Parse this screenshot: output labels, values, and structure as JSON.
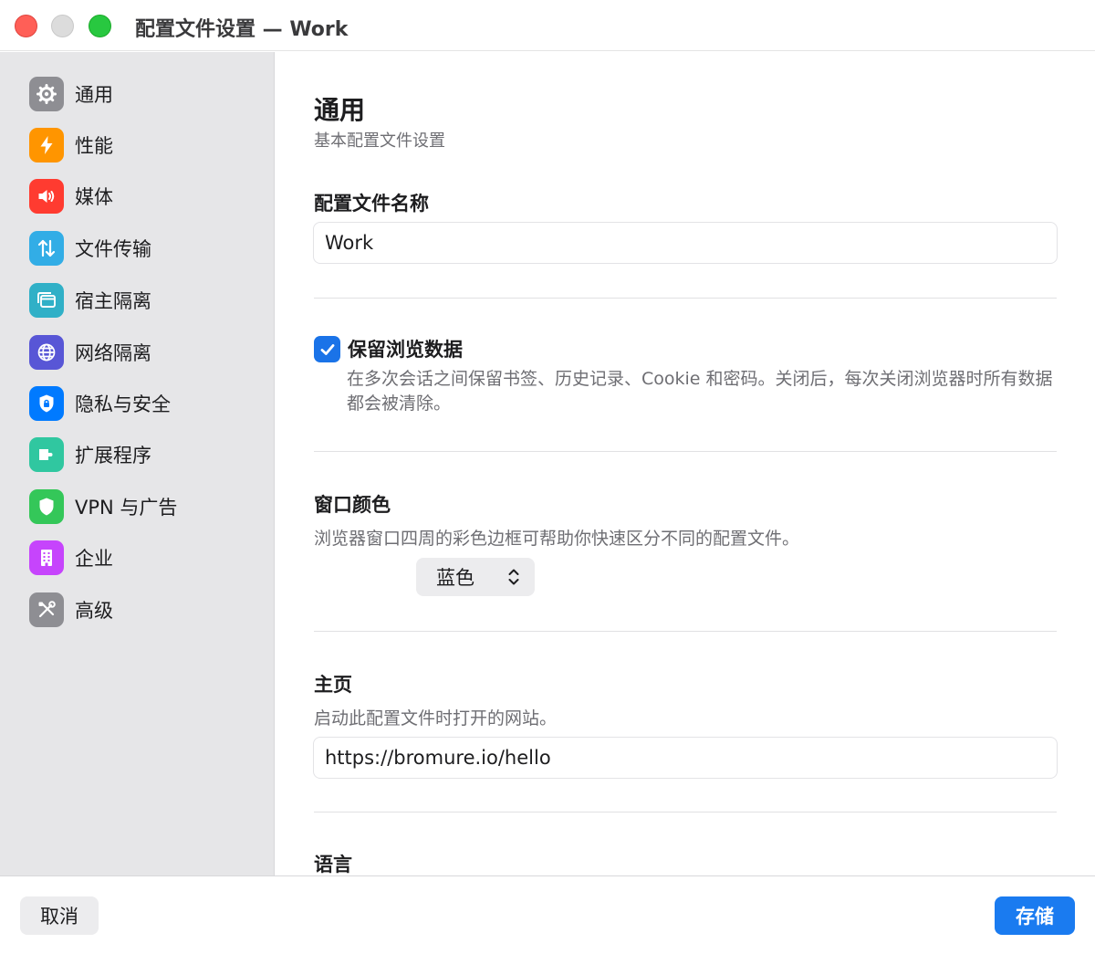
{
  "window": {
    "title": "配置文件设置 — Work"
  },
  "sidebar": {
    "items": [
      {
        "label": "通用",
        "icon": "gear-icon",
        "color": "#8e8e93"
      },
      {
        "label": "性能",
        "icon": "bolt-icon",
        "color": "#ff9500"
      },
      {
        "label": "媒体",
        "icon": "speaker-icon",
        "color": "#ff3b30"
      },
      {
        "label": "文件传输",
        "icon": "transfer-arrows-icon",
        "color": "#32ade6"
      },
      {
        "label": "宿主隔离",
        "icon": "window-icon",
        "color": "#30b0c7"
      },
      {
        "label": "网络隔离",
        "icon": "globe-icon",
        "color": "#5856d6"
      },
      {
        "label": "隐私与安全",
        "icon": "lock-shield-icon",
        "color": "#007aff"
      },
      {
        "label": "扩展程序",
        "icon": "puzzle-icon",
        "color": "#30c7a0"
      },
      {
        "label": "VPN 与广告",
        "icon": "shield-icon",
        "color": "#34c759"
      },
      {
        "label": "企业",
        "icon": "building-icon",
        "color": "#c644fc"
      },
      {
        "label": "高级",
        "icon": "tools-icon",
        "color": "#8e8e93"
      }
    ]
  },
  "main": {
    "title": "通用",
    "subtitle": "基本配置文件设置",
    "profile_name": {
      "label": "配置文件名称",
      "value": "Work"
    },
    "keep_browsing_data": {
      "label": "保留浏览数据",
      "checked": true,
      "description": "在多次会话之间保留书签、历史记录、Cookie 和密码。关闭后，每次关闭浏览器时所有数据都会被清除。"
    },
    "window_color": {
      "label": "窗口颜色",
      "description": "浏览器窗口四周的彩色边框可帮助你快速区分不同的配置文件。",
      "selected": "蓝色"
    },
    "homepage": {
      "label": "主页",
      "description": "启动此配置文件时打开的网站。",
      "value": "https://bromure.io/hello"
    },
    "language": {
      "label": "语言"
    }
  },
  "footer": {
    "cancel_label": "取消",
    "save_label": "存储"
  },
  "colors": {
    "accent": "#1a7bf0",
    "sidebar_bg": "#e6e6e8"
  }
}
